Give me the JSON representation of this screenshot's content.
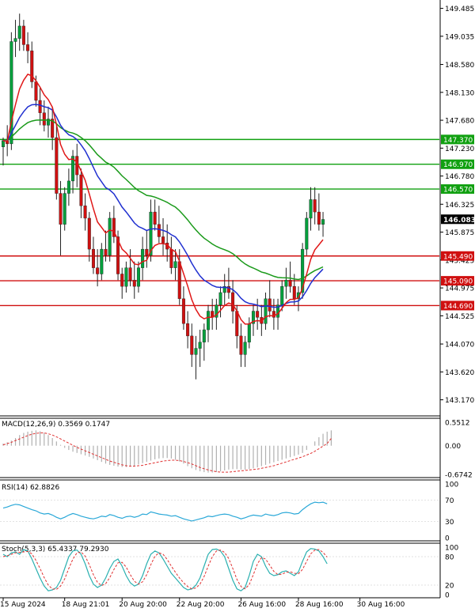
{
  "colors": {
    "bull": "#00a03c",
    "bear": "#d01010",
    "ma_slow": "#1a9a1a",
    "ma_mid": "#2030d0",
    "ma_fast": "#e01818",
    "support_line": "#d01010",
    "resistance_line": "#10a010",
    "price_tag": "#000000",
    "macd_hist": "#b0b0b0",
    "macd_signal": "#e03030",
    "rsi": "#2aa8d8",
    "stoch_main": "#2ab0b0",
    "stoch_signal": "#e03030"
  },
  "chart_data": [
    {
      "type": "candlestick",
      "panel": "price",
      "price_axis_ticks": [
        149.485,
        149.035,
        148.58,
        148.13,
        147.68,
        147.23,
        146.78,
        146.325,
        145.875,
        145.425,
        144.975,
        144.525,
        144.07,
        143.62,
        143.17
      ],
      "ylim": [
        142.91,
        149.62
      ],
      "current_price": "146.083",
      "current_value": 146.083,
      "levels": [
        {
          "label": "147.370",
          "value": 147.37,
          "kind": "resistance"
        },
        {
          "label": "146.970",
          "value": 146.97,
          "kind": "resistance"
        },
        {
          "label": "146.570",
          "value": 146.57,
          "kind": "resistance"
        },
        {
          "label": "145.490",
          "value": 145.49,
          "kind": "support"
        },
        {
          "label": "145.090",
          "value": 145.09,
          "kind": "support"
        },
        {
          "label": "144.690",
          "value": 144.69,
          "kind": "support"
        }
      ],
      "x_labels": [
        "15 Aug 2024",
        "18 Aug 21:01",
        "20 Aug 20:00",
        "22 Aug 20:00",
        "26 Aug 16:00",
        "28 Aug 16:00",
        "30 Aug 16:00"
      ],
      "x_label_index": [
        0,
        15,
        29,
        43,
        58,
        72,
        87
      ],
      "candles": [
        [
          147.25,
          147.4,
          146.95,
          147.35
        ],
        [
          147.35,
          147.6,
          147.1,
          147.3
        ],
        [
          147.3,
          149.1,
          147.2,
          148.95
        ],
        [
          148.95,
          149.3,
          148.7,
          149.0
        ],
        [
          149.0,
          149.4,
          148.8,
          149.2
        ],
        [
          149.2,
          149.3,
          148.8,
          148.9
        ],
        [
          148.9,
          149.1,
          148.6,
          148.8
        ],
        [
          148.8,
          148.95,
          148.2,
          148.3
        ],
        [
          148.3,
          148.4,
          147.9,
          148.0
        ],
        [
          148.0,
          148.2,
          147.6,
          147.8
        ],
        [
          147.8,
          148.0,
          147.5,
          147.6
        ],
        [
          147.6,
          147.9,
          147.4,
          147.7
        ],
        [
          147.7,
          147.9,
          147.2,
          147.4
        ],
        [
          147.4,
          147.6,
          146.4,
          146.5
        ],
        [
          146.5,
          146.7,
          145.5,
          146.0
        ],
        [
          146.0,
          146.6,
          145.9,
          146.5
        ],
        [
          146.5,
          146.9,
          146.3,
          146.7
        ],
        [
          146.7,
          147.2,
          146.5,
          147.1
        ],
        [
          147.1,
          147.3,
          146.6,
          146.8
        ],
        [
          146.8,
          146.9,
          146.1,
          146.3
        ],
        [
          146.3,
          146.5,
          145.9,
          146.1
        ],
        [
          146.1,
          146.2,
          145.4,
          145.6
        ],
        [
          145.6,
          145.8,
          145.2,
          145.3
        ],
        [
          145.3,
          145.6,
          145.0,
          145.2
        ],
        [
          145.2,
          145.7,
          145.1,
          145.6
        ],
        [
          145.6,
          145.9,
          145.4,
          145.5
        ],
        [
          145.5,
          146.2,
          145.4,
          146.1
        ],
        [
          146.1,
          146.3,
          145.7,
          145.8
        ],
        [
          145.8,
          145.9,
          145.1,
          145.2
        ],
        [
          145.2,
          145.3,
          144.8,
          145.0
        ],
        [
          145.0,
          145.4,
          144.9,
          145.3
        ],
        [
          145.3,
          145.6,
          145.0,
          145.1
        ],
        [
          145.1,
          145.4,
          144.8,
          145.0
        ],
        [
          145.0,
          145.4,
          144.9,
          145.3
        ],
        [
          145.3,
          145.8,
          145.1,
          145.6
        ],
        [
          145.6,
          145.9,
          145.3,
          145.5
        ],
        [
          145.5,
          146.4,
          145.4,
          146.2
        ],
        [
          146.2,
          146.4,
          145.9,
          146.0
        ],
        [
          146.0,
          146.3,
          145.7,
          145.8
        ],
        [
          145.8,
          146.1,
          145.5,
          145.7
        ],
        [
          145.7,
          146.0,
          145.4,
          145.6
        ],
        [
          145.6,
          145.8,
          145.2,
          145.3
        ],
        [
          145.3,
          145.6,
          145.1,
          145.4
        ],
        [
          145.4,
          145.6,
          144.7,
          144.8
        ],
        [
          144.8,
          145.0,
          144.3,
          144.4
        ],
        [
          144.4,
          144.6,
          144.0,
          144.2
        ],
        [
          144.2,
          144.4,
          143.7,
          143.9
        ],
        [
          143.9,
          144.2,
          143.5,
          144.0
        ],
        [
          144.0,
          144.3,
          143.7,
          144.1
        ],
        [
          144.1,
          144.4,
          143.8,
          144.3
        ],
        [
          144.3,
          144.7,
          144.1,
          144.6
        ],
        [
          144.6,
          144.8,
          144.3,
          144.5
        ],
        [
          144.5,
          144.8,
          144.3,
          144.7
        ],
        [
          144.7,
          145.0,
          144.5,
          144.9
        ],
        [
          144.9,
          145.2,
          144.7,
          145.0
        ],
        [
          145.0,
          145.3,
          144.8,
          144.9
        ],
        [
          144.9,
          145.1,
          144.4,
          144.6
        ],
        [
          144.6,
          144.7,
          144.0,
          144.2
        ],
        [
          144.2,
          144.4,
          143.7,
          143.9
        ],
        [
          143.9,
          144.2,
          143.7,
          144.1
        ],
        [
          144.1,
          144.5,
          144.0,
          144.4
        ],
        [
          144.4,
          144.7,
          144.2,
          144.6
        ],
        [
          144.6,
          144.8,
          144.3,
          144.5
        ],
        [
          144.5,
          144.7,
          144.2,
          144.4
        ],
        [
          144.4,
          144.9,
          144.3,
          144.8
        ],
        [
          144.8,
          145.1,
          144.5,
          144.6
        ],
        [
          144.6,
          144.8,
          144.3,
          144.5
        ],
        [
          144.5,
          144.8,
          144.3,
          144.7
        ],
        [
          144.7,
          145.1,
          144.6,
          145.0
        ],
        [
          145.0,
          145.3,
          144.8,
          145.1
        ],
        [
          145.1,
          145.4,
          144.9,
          145.0
        ],
        [
          145.0,
          145.2,
          144.7,
          144.8
        ],
        [
          144.8,
          145.0,
          144.6,
          144.9
        ],
        [
          144.9,
          145.7,
          144.8,
          145.6
        ],
        [
          145.6,
          146.2,
          145.5,
          146.1
        ],
        [
          146.1,
          146.6,
          145.9,
          146.4
        ],
        [
          146.4,
          146.6,
          146.0,
          146.2
        ],
        [
          146.2,
          146.5,
          145.9,
          146.0
        ],
        [
          146.0,
          146.2,
          145.8,
          146.08
        ]
      ]
    },
    {
      "type": "line",
      "panel": "macd",
      "title": "MACD(12,26,9) 0.3569 0.1747",
      "axis_ticks": [
        "0.5512",
        "0.00",
        "-0.6742"
      ],
      "ylim": [
        -0.6742,
        0.5512
      ],
      "histogram_values": [
        0.05,
        0.08,
        0.12,
        0.18,
        0.25,
        0.3,
        0.33,
        0.35,
        0.36,
        0.34,
        0.3,
        0.25,
        0.18,
        0.1,
        0.02,
        -0.05,
        -0.1,
        -0.14,
        -0.17,
        -0.2,
        -0.23,
        -0.26,
        -0.3,
        -0.34,
        -0.38,
        -0.42,
        -0.45,
        -0.47,
        -0.49,
        -0.5,
        -0.5,
        -0.49,
        -0.47,
        -0.44,
        -0.41,
        -0.38,
        -0.35,
        -0.32,
        -0.3,
        -0.29,
        -0.29,
        -0.3,
        -0.33,
        -0.37,
        -0.42,
        -0.48,
        -0.53,
        -0.57,
        -0.6,
        -0.62,
        -0.63,
        -0.63,
        -0.62,
        -0.6,
        -0.58,
        -0.56,
        -0.55,
        -0.55,
        -0.56,
        -0.56,
        -0.55,
        -0.53,
        -0.51,
        -0.48,
        -0.45,
        -0.42,
        -0.39,
        -0.36,
        -0.33,
        -0.3,
        -0.27,
        -0.24,
        -0.21,
        -0.17,
        -0.1,
        0.0,
        0.1,
        0.2,
        0.28,
        0.33,
        0.36
      ],
      "signal_values": [
        0.02,
        0.05,
        0.08,
        0.12,
        0.16,
        0.2,
        0.24,
        0.27,
        0.29,
        0.3,
        0.3,
        0.28,
        0.25,
        0.21,
        0.16,
        0.11,
        0.06,
        0.01,
        -0.04,
        -0.08,
        -0.12,
        -0.16,
        -0.2,
        -0.24,
        -0.28,
        -0.32,
        -0.36,
        -0.39,
        -0.42,
        -0.45,
        -0.47,
        -0.48,
        -0.48,
        -0.47,
        -0.46,
        -0.44,
        -0.42,
        -0.4,
        -0.38,
        -0.36,
        -0.35,
        -0.34,
        -0.34,
        -0.35,
        -0.37,
        -0.4,
        -0.43,
        -0.47,
        -0.51,
        -0.54,
        -0.57,
        -0.59,
        -0.61,
        -0.62,
        -0.62,
        -0.62,
        -0.61,
        -0.6,
        -0.59,
        -0.58,
        -0.57,
        -0.56,
        -0.55,
        -0.53,
        -0.51,
        -0.49,
        -0.47,
        -0.44,
        -0.41,
        -0.38,
        -0.35,
        -0.32,
        -0.29,
        -0.26,
        -0.22,
        -0.18,
        -0.13,
        -0.07,
        -0.01,
        0.05,
        0.17
      ]
    },
    {
      "type": "line",
      "panel": "rsi",
      "title": "RSI(14) 62.8826",
      "axis_ticks": [
        "100",
        "70",
        "30",
        "0"
      ],
      "ylim": [
        0,
        100
      ],
      "values": [
        55,
        57,
        60,
        62,
        61,
        58,
        55,
        52,
        50,
        46,
        44,
        45,
        42,
        38,
        35,
        38,
        42,
        45,
        43,
        40,
        38,
        36,
        35,
        37,
        40,
        39,
        43,
        41,
        38,
        36,
        39,
        40,
        38,
        40,
        44,
        43,
        48,
        46,
        44,
        43,
        42,
        40,
        41,
        38,
        35,
        33,
        31,
        33,
        35,
        37,
        40,
        39,
        41,
        43,
        44,
        43,
        40,
        38,
        35,
        37,
        40,
        42,
        41,
        40,
        44,
        42,
        41,
        43,
        46,
        47,
        46,
        44,
        45,
        52,
        58,
        63,
        66,
        65,
        66,
        63
      ]
    },
    {
      "type": "line",
      "panel": "stoch",
      "title": "Stoch(5,3,3) 65.4337 79.2930",
      "axis_ticks": [
        "100",
        "80",
        "20",
        "0"
      ],
      "ylim": [
        0,
        100
      ],
      "main_values": [
        85,
        80,
        88,
        90,
        85,
        95,
        92,
        75,
        55,
        35,
        18,
        8,
        10,
        15,
        30,
        55,
        80,
        92,
        94,
        85,
        65,
        40,
        22,
        15,
        20,
        35,
        55,
        70,
        75,
        60,
        40,
        25,
        18,
        22,
        40,
        65,
        85,
        92,
        88,
        75,
        60,
        45,
        35,
        25,
        15,
        10,
        12,
        20,
        35,
        60,
        85,
        95,
        96,
        92,
        80,
        55,
        30,
        12,
        8,
        15,
        40,
        70,
        85,
        80,
        60,
        45,
        40,
        42,
        48,
        50,
        45,
        40,
        48,
        70,
        90,
        97,
        96,
        92,
        80,
        65
      ],
      "signal_values": [
        80,
        82,
        85,
        88,
        89,
        90,
        91,
        86,
        72,
        55,
        36,
        20,
        12,
        11,
        18,
        33,
        55,
        75,
        88,
        90,
        81,
        63,
        42,
        26,
        19,
        23,
        36,
        53,
        67,
        68,
        58,
        42,
        28,
        22,
        27,
        42,
        63,
        81,
        88,
        85,
        74,
        60,
        47,
        35,
        25,
        17,
        12,
        14,
        22,
        38,
        60,
        80,
        92,
        94,
        89,
        76,
        55,
        32,
        17,
        12,
        21,
        42,
        65,
        78,
        75,
        62,
        49,
        42,
        43,
        47,
        48,
        45,
        44,
        53,
        70,
        86,
        94,
        95,
        89,
        79
      ]
    }
  ]
}
